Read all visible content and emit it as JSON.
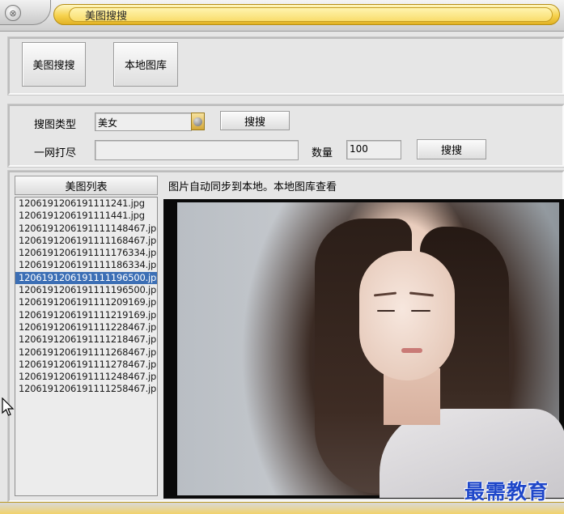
{
  "window": {
    "title": "美图搜搜",
    "close_glyph": "⊗"
  },
  "nav": {
    "meitu_button": "美图搜搜",
    "local_gallery_button": "本地图库"
  },
  "search": {
    "type_label": "搜图类型",
    "type_value": "美女",
    "search_button": "搜搜",
    "batch_label": "一网打尽",
    "batch_value": "",
    "count_label": "数量",
    "count_value": "100",
    "batch_search_button": "搜搜"
  },
  "list": {
    "header": "美图列表",
    "selected_index": 6,
    "items": [
      "1206191206191111241.jpg",
      "1206191206191111441.jpg",
      "1206191206191111148467.jp",
      "1206191206191111168467.jp",
      "1206191206191111176334.jp",
      "1206191206191111186334.jp",
      "1206191206191111196500.jp",
      "1206191206191111196500.jp",
      "1206191206191111209169.jp",
      "1206191206191111219169.jp",
      "1206191206191111228467.jp",
      "1206191206191111218467.jp",
      "1206191206191111268467.jp",
      "1206191206191111278467.jp",
      "1206191206191111248467.jp",
      "1206191206191111258467.jp"
    ]
  },
  "viewer": {
    "hint": "图片自动同步到本地。本地图库查看",
    "image_subject": "photo-of-woman"
  },
  "watermark": {
    "text": "最需教育"
  },
  "colors": {
    "title_gold": "#f6d24e",
    "selection_blue": "#3c6fb5",
    "watermark_blue": "#1f47c9"
  }
}
